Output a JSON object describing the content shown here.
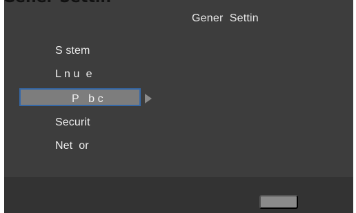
{
  "header": {
    "logo_fragment": "Gener Settin",
    "title": "Gener  Settin"
  },
  "menu": {
    "items": [
      {
        "label": "S stem"
      },
      {
        "label": "L n u  e"
      },
      {
        "label": "P   b c"
      },
      {
        "label": "Securit"
      },
      {
        "label": "Net  or"
      }
    ],
    "selected_index": 2
  },
  "footer": {
    "button_label": ""
  },
  "colors": {
    "background": "#3d3d3d",
    "footer": "#333333",
    "selected_fill": "#7d7d7d",
    "selected_border": "#3468a8",
    "text": "#f0f0f0"
  }
}
